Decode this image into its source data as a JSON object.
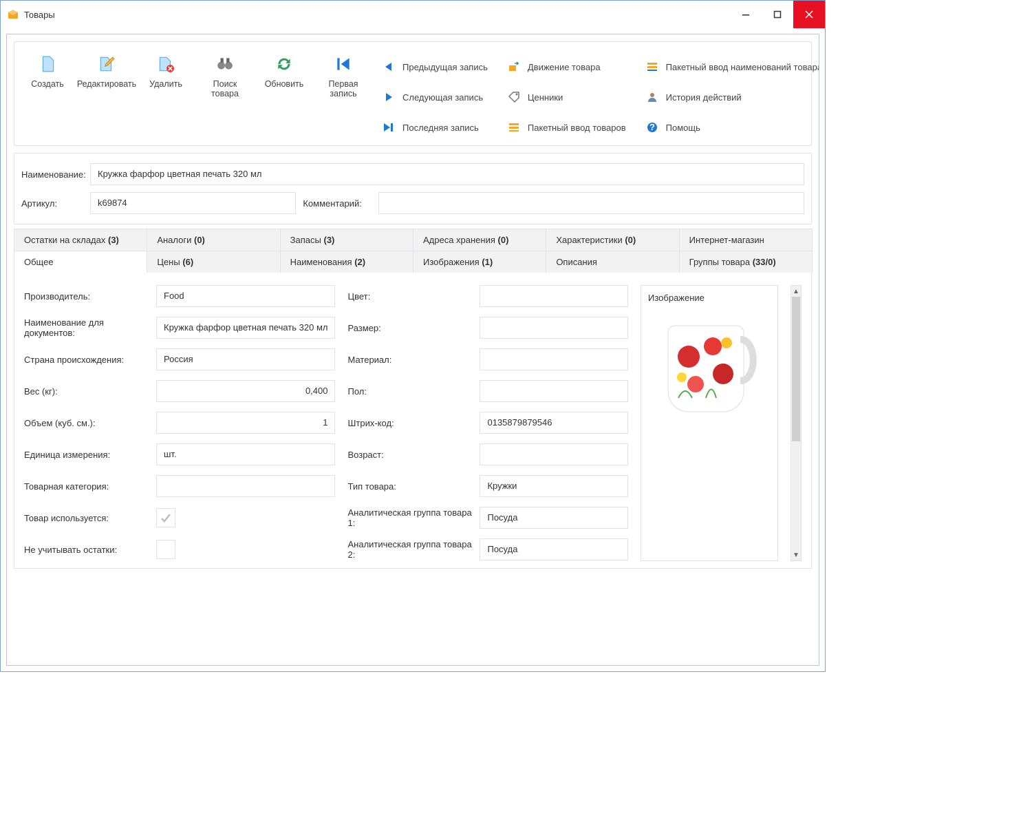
{
  "window": {
    "title": "Товары"
  },
  "toolbar": {
    "create": "Создать",
    "edit": "Редактировать",
    "delete": "Удалить",
    "search": "Поиск товара",
    "refresh": "Обновить",
    "first": "Первая запись",
    "prev": "Предыдущая запись",
    "next": "Следующая запись",
    "last": "Последняя запись",
    "movement": "Движение товара",
    "pricetags": "Ценники",
    "batch_goods": "Пакетный ввод товаров",
    "batch_names": "Пакетный ввод наименований товара",
    "history": "История действий",
    "help": "Помощь"
  },
  "header": {
    "name_label": "Наименование:",
    "name_value": "Кружка фарфор цветная печать 320 мл",
    "sku_label": "Артикул:",
    "sku_value": "k69874",
    "comment_label": "Комментарий:",
    "comment_value": ""
  },
  "tabs_row1": [
    {
      "label": "Остатки на складах",
      "count": "(3)"
    },
    {
      "label": "Аналоги",
      "count": "(0)"
    },
    {
      "label": "Запасы",
      "count": "(3)"
    },
    {
      "label": "Адреса хранения",
      "count": "(0)"
    },
    {
      "label": "Характеристики",
      "count": "(0)"
    },
    {
      "label": "Интернет-магазин",
      "count": ""
    }
  ],
  "tabs_row2": [
    {
      "label": "Общее",
      "count": ""
    },
    {
      "label": "Цены",
      "count": "(6)"
    },
    {
      "label": "Наименования",
      "count": "(2)"
    },
    {
      "label": "Изображения",
      "count": "(1)"
    },
    {
      "label": "Описания",
      "count": ""
    },
    {
      "label": "Группы товара",
      "count": "(33/0)"
    }
  ],
  "fields": {
    "manufacturer_label": "Производитель:",
    "manufacturer_value": "Food",
    "docname_label": "Наименование для документов:",
    "docname_value": "Кружка фарфор цветная печать 320 мл",
    "country_label": "Страна происхождения:",
    "country_value": "Россия",
    "weight_label": "Вес (кг):",
    "weight_value": "0,400",
    "volume_label": "Объем (куб. см.):",
    "volume_value": "1",
    "unit_label": "Единица измерения:",
    "unit_value": "шт.",
    "category_label": "Товарная категория:",
    "category_value": "",
    "inuse_label": "Товар используется:",
    "ignore_stock_label": "Не учитывать остатки:",
    "color_label": "Цвет:",
    "color_value": "",
    "size_label": "Размер:",
    "size_value": "",
    "material_label": "Материал:",
    "material_value": "",
    "gender_label": "Пол:",
    "gender_value": "",
    "barcode_label": "Штрих-код:",
    "barcode_value": "0135879879546",
    "age_label": "Возраст:",
    "age_value": "",
    "type_label": "Тип товара:",
    "type_value": "Кружки",
    "agroup1_label": "Аналитическая группа товара 1:",
    "agroup1_value": "Посуда",
    "agroup2_label": "Аналитическая группа товара 2:",
    "agroup2_value": "Посуда",
    "image_label": "Изображение"
  }
}
